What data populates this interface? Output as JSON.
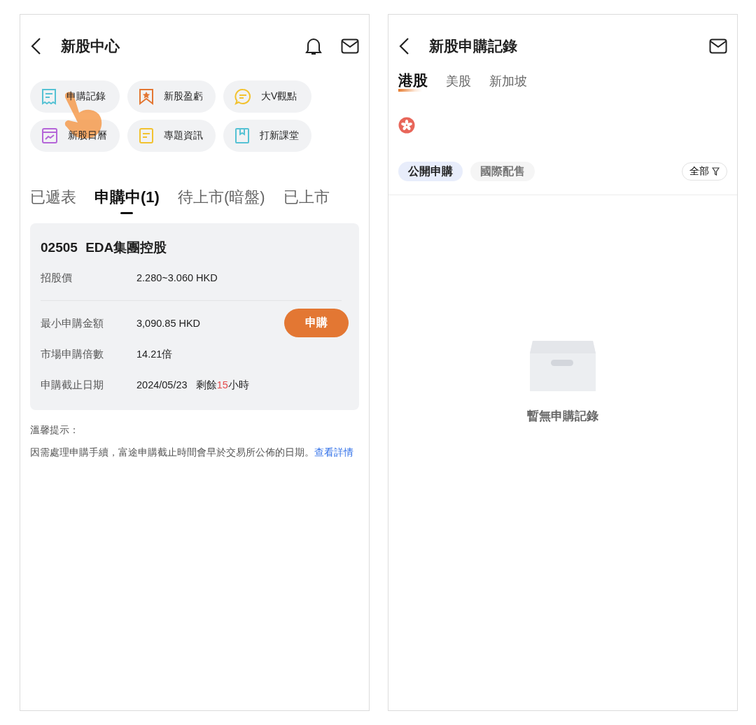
{
  "left_screen": {
    "title": "新股中心",
    "shortcuts": [
      {
        "label": "申購記錄",
        "kind": "receipt"
      },
      {
        "label": "新股盈虧",
        "kind": "bookmark"
      },
      {
        "label": "大V觀點",
        "kind": "chat"
      },
      {
        "label": "新股日曆",
        "kind": "calendar"
      },
      {
        "label": "專題資訊",
        "kind": "note"
      },
      {
        "label": "打新課堂",
        "kind": "book"
      }
    ],
    "tabs": [
      {
        "label": "已遞表",
        "selected": false
      },
      {
        "label": "申購中(1)",
        "selected": true
      },
      {
        "label": "待上市(暗盤)",
        "selected": false
      },
      {
        "label": "已上市",
        "selected": false
      }
    ],
    "ipo": {
      "code": "02505",
      "name": "EDA集團控股",
      "price_label": "招股價",
      "price_value": "2.280~3.060 HKD",
      "rows": [
        {
          "label": "最小申購金額",
          "value": "3,090.85 HKD"
        },
        {
          "label": "市場申購倍數",
          "value": "14.21倍"
        }
      ],
      "deadline_label": "申購截止日期",
      "deadline_date": "2024/05/23",
      "remaining_before": "剩餘",
      "remaining_hours": "15",
      "remaining_after": "小時",
      "button": "申購"
    },
    "notice": {
      "title": "溫馨提示：",
      "text": "因需處理申購手續，富途申購截止時間會早於交易所公佈的日期。",
      "link": "查看詳情"
    }
  },
  "right_screen": {
    "title": "新股申購記錄",
    "markets": [
      {
        "label": "港股",
        "selected": true
      },
      {
        "label": "美股",
        "selected": false
      },
      {
        "label": "新加坡",
        "selected": false
      }
    ],
    "chips": [
      {
        "label": "公開申購",
        "selected": true
      },
      {
        "label": "國際配售",
        "selected": false
      }
    ],
    "filter": "全部",
    "empty_text": "暫無申購記錄"
  }
}
